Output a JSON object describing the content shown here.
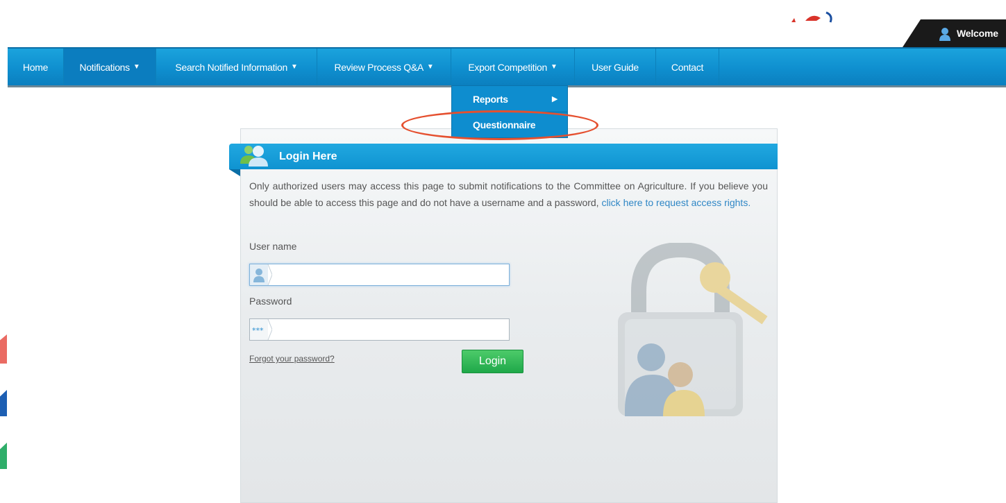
{
  "header": {
    "welcome_label": "Welcome"
  },
  "nav": {
    "items": [
      {
        "label": "Home",
        "has_dropdown": false
      },
      {
        "label": "Notifications",
        "has_dropdown": true
      },
      {
        "label": "Search Notified Information",
        "has_dropdown": true
      },
      {
        "label": "Review Process Q&A",
        "has_dropdown": true
      },
      {
        "label": "Export Competition",
        "has_dropdown": true
      },
      {
        "label": "User Guide",
        "has_dropdown": false
      },
      {
        "label": "Contact",
        "has_dropdown": false
      }
    ],
    "dropdown_arrow": "▼"
  },
  "dropdown": {
    "items": [
      {
        "label": "Reports",
        "has_submenu": true
      },
      {
        "label": "Questionnaire",
        "has_submenu": false
      }
    ],
    "submenu_arrow": "▶"
  },
  "login": {
    "title": "Login Here",
    "intro_text": "Only authorized users may access this page to submit notifications to the Committee on Agriculture. If you believe you should be able to access this page and do not have a username and a password, ",
    "intro_link": "click here to request access rights.",
    "username_label": "User name",
    "username_value": "",
    "password_label": "Password",
    "password_value": "",
    "forgot_link": "Forgot your password?",
    "login_button": "Login"
  },
  "colors": {
    "nav_blue": "#0f8fcf",
    "login_green": "#1fa849",
    "highlight_red": "#e5502f"
  }
}
